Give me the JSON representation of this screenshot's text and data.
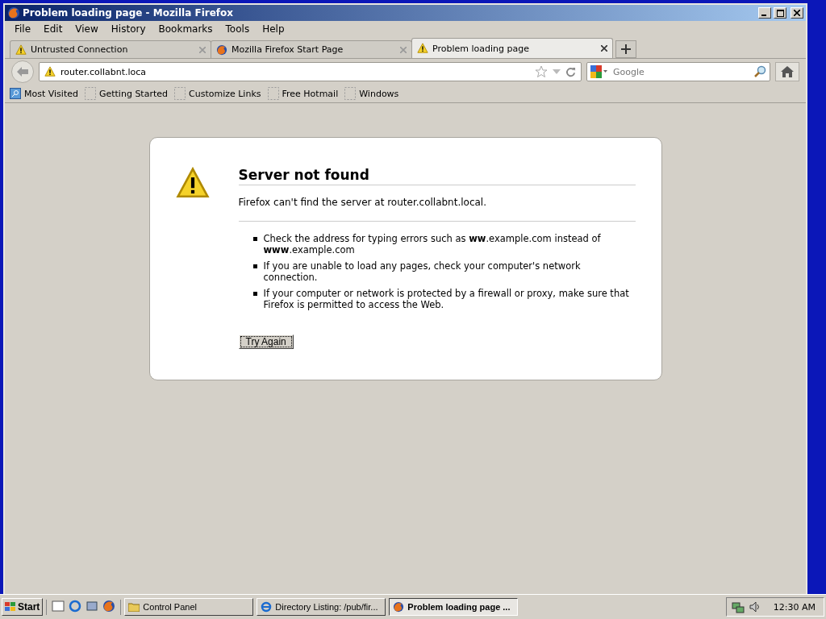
{
  "window": {
    "title": "Problem loading page - Mozilla Firefox"
  },
  "menu": [
    "File",
    "Edit",
    "View",
    "History",
    "Bookmarks",
    "Tools",
    "Help"
  ],
  "tabs": [
    {
      "label": "Untrusted Connection",
      "kind": "warning",
      "selected": false
    },
    {
      "label": "Mozilla Firefox Start Page",
      "kind": "firefox",
      "selected": false
    },
    {
      "label": "Problem loading page",
      "kind": "warning",
      "selected": true
    }
  ],
  "address": {
    "value": "router.collabnt.loca"
  },
  "search": {
    "placeholder": "Google"
  },
  "bookmarks": [
    "Most Visited",
    "Getting Started",
    "Customize Links",
    "Free Hotmail",
    "Windows"
  ],
  "error": {
    "title": "Server not found",
    "message": "Firefox can't find the server at router.collabnt.local.",
    "tips": [
      "Check the address for typing errors such as **ww**.example.com instead of **www**.example.com",
      "If you are unable to load any pages, check your computer's network connection.",
      "If your computer or network is protected by a firewall or proxy, make sure that Firefox is permitted to access the Web."
    ],
    "button": "Try Again"
  },
  "taskbar": {
    "start": "Start",
    "tasks": [
      {
        "label": "Control Panel",
        "kind": "folder",
        "selected": false
      },
      {
        "label": "Directory Listing: /pub/fir...",
        "kind": "ie",
        "selected": false
      },
      {
        "label": "Problem loading page ...",
        "kind": "firefox",
        "selected": true
      }
    ],
    "clock": "12:30 AM"
  }
}
